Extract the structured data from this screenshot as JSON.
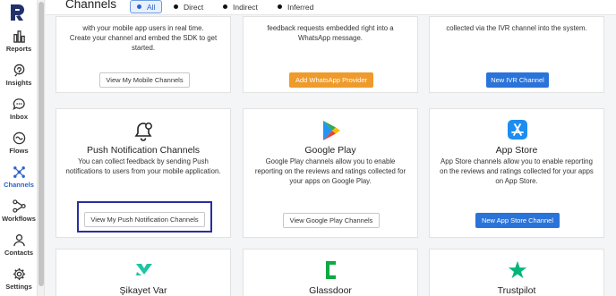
{
  "header": {
    "title": "Channels",
    "filters": [
      {
        "label": "All",
        "active": true
      },
      {
        "label": "Direct",
        "active": false
      },
      {
        "label": "Indirect",
        "active": false
      },
      {
        "label": "Inferred",
        "active": false
      }
    ]
  },
  "sidebar": {
    "items": [
      {
        "label": "Reports",
        "icon": "bar-chart-icon"
      },
      {
        "label": "Insights",
        "icon": "insights-icon"
      },
      {
        "label": "Inbox",
        "icon": "chat-bubble-icon"
      },
      {
        "label": "Flows",
        "icon": "flows-icon"
      },
      {
        "label": "Channels",
        "icon": "channels-icon",
        "active": true
      },
      {
        "label": "Workflows",
        "icon": "workflows-icon"
      },
      {
        "label": "Contacts",
        "icon": "person-icon"
      },
      {
        "label": "Settings",
        "icon": "gear-icon"
      }
    ]
  },
  "cards": {
    "mobile": {
      "desc": "Create your channel and embed the SDK to get started.",
      "desc_partial_top": "with your mobile app users in real time.",
      "button": "View My Mobile Channels"
    },
    "whatsapp": {
      "desc": "feedback requests embedded right into a WhatsApp message.",
      "button": "Add WhatsApp Provider"
    },
    "ivr": {
      "desc": "collected via the IVR channel into the system.",
      "button": "New IVR Channel"
    },
    "push": {
      "title": "Push Notification Channels",
      "desc": "You can collect feedback by sending Push notifications to users from your mobile application.",
      "button": "View My Push Notification Channels"
    },
    "googleplay": {
      "title": "Google Play",
      "desc": "Google Play channels allow you to enable reporting on the reviews and ratings collected for your apps on Google Play.",
      "button": "View Google Play Channels"
    },
    "appstore": {
      "title": "App Store",
      "desc": "App Store channels allow you to enable reporting on the reviews and ratings collected for your apps on App Store.",
      "button": "New App Store Channel"
    },
    "sikayetvar": {
      "title": "Şikayet Var"
    },
    "glassdoor": {
      "title": "Glassdoor"
    },
    "trustpilot": {
      "title": "Trustpilot"
    }
  },
  "colors": {
    "accent": "#2a64c9",
    "button_blue": "#2a73d9",
    "button_orange": "#ee9b2c",
    "highlight": "#2a2f9e"
  }
}
